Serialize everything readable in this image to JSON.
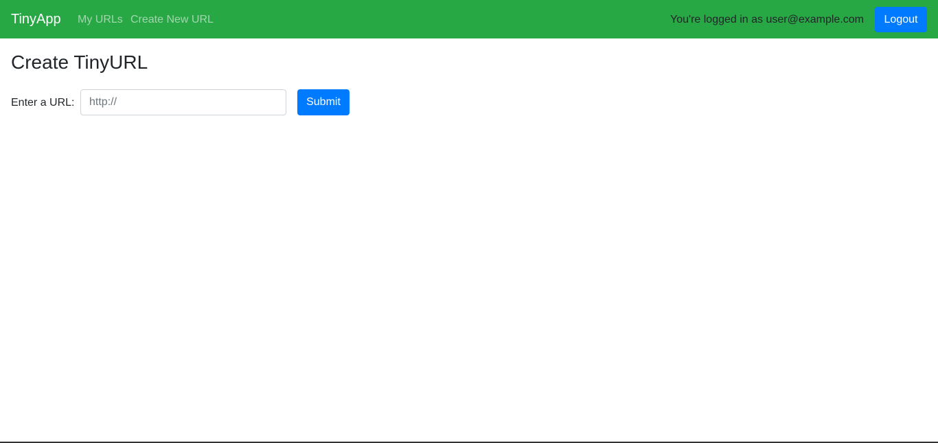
{
  "navbar": {
    "brand": "TinyApp",
    "links": [
      {
        "label": "My URLs"
      },
      {
        "label": "Create New URL"
      }
    ],
    "login_status": "You're logged in as user@example.com",
    "logout_label": "Logout"
  },
  "main": {
    "title": "Create TinyURL",
    "form": {
      "label": "Enter a URL:",
      "input_value": "",
      "input_placeholder": "http://",
      "submit_label": "Submit"
    }
  },
  "colors": {
    "navbar_bg": "#28a745",
    "primary_button": "#007bff",
    "nav_link": "rgba(255,255,255,0.55)"
  }
}
